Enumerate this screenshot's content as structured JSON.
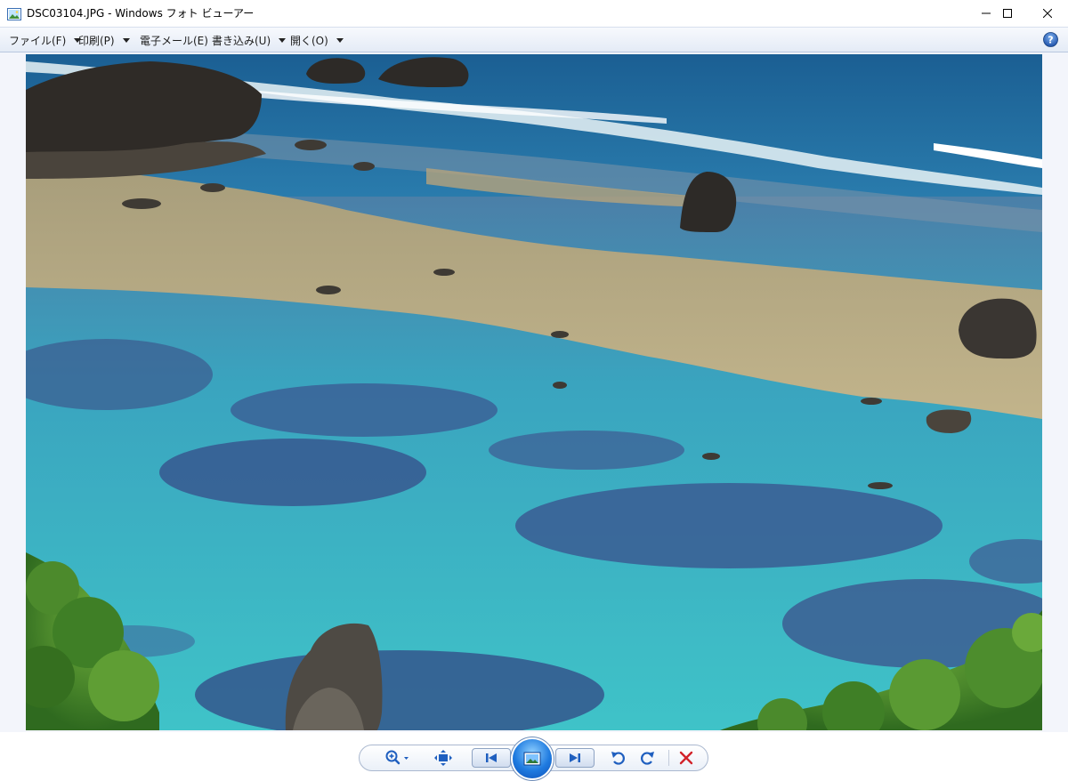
{
  "window": {
    "title": "DSC03104.JPG - Windows フォト ビューアー",
    "icon": "photo-viewer-app-icon",
    "controls": [
      "minimize-icon",
      "maximize-icon",
      "close-icon"
    ]
  },
  "menu": {
    "items": [
      {
        "label": "ファイル(F)",
        "dropdown": true
      },
      {
        "label": "印刷(P)",
        "dropdown": true
      },
      {
        "label": "電子メール(E)",
        "dropdown": false
      },
      {
        "label": "書き込み(U)",
        "dropdown": true
      },
      {
        "label": "開く(O)",
        "dropdown": true
      }
    ],
    "help_icon": "help-icon"
  },
  "image": {
    "subject": "coastal coral reef with turquoise water, rocks and green shrubs"
  },
  "controls": {
    "buttons": [
      "zoom-icon",
      "fit-to-window-icon",
      "previous-icon",
      "slideshow-icon",
      "next-icon",
      "rotate-counterclockwise-icon",
      "rotate-clockwise-icon",
      "delete-icon"
    ]
  },
  "colors": {
    "menu_bg": "#e4ebf6",
    "viewer_bg": "#f3f5fb",
    "accent_blue": "#1f5fbf",
    "delete_red": "#d2232a"
  }
}
